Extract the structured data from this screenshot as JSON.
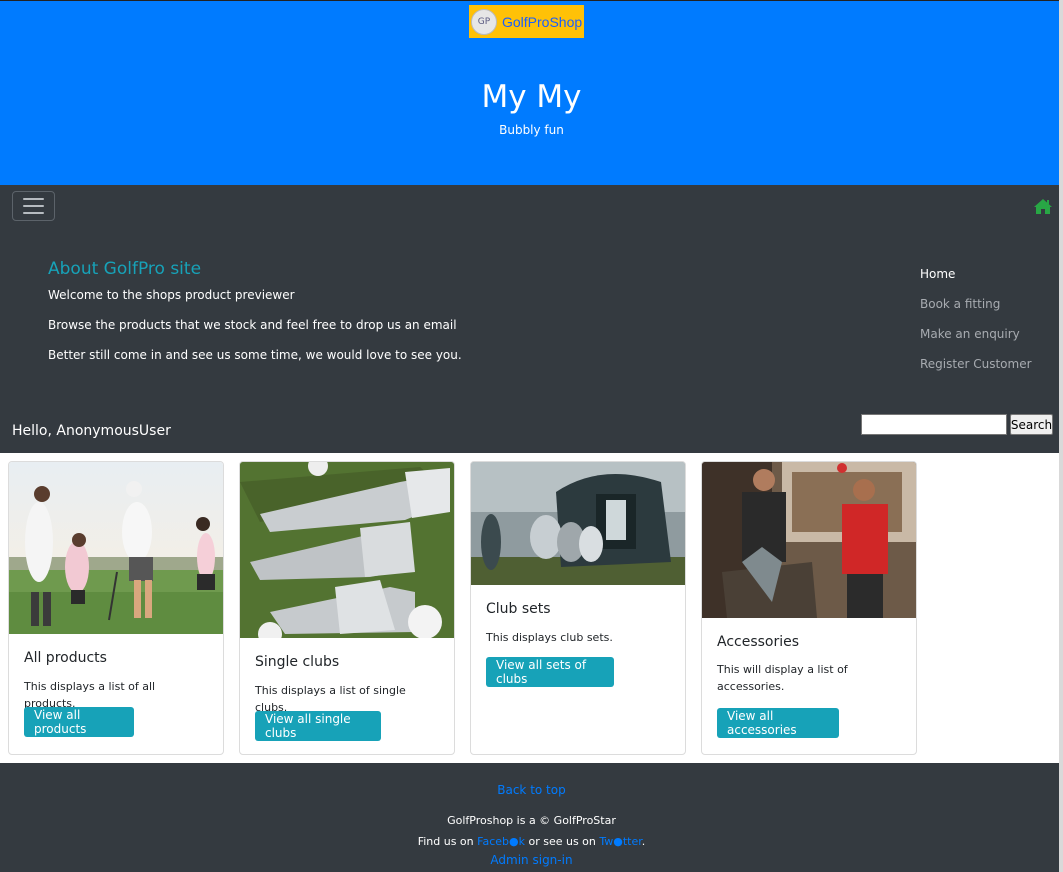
{
  "header": {
    "brand_badge": "GP",
    "brand_name": "GolfProShop",
    "title": "My My",
    "subtitle": "Bubbly fun"
  },
  "navbar": {
    "toggle_icon": "hamburger-icon",
    "home_icon": "home-icon",
    "about": {
      "title": "About GolfPro site",
      "lines": [
        "Welcome to the shops product previewer",
        "Browse the products that we stock and feel free to drop us an email",
        "Better still come in and see us some time, we would love to see you."
      ]
    },
    "links": [
      {
        "label": "Home",
        "active": true
      },
      {
        "label": "Book a fitting",
        "active": false
      },
      {
        "label": "Make an enquiry",
        "active": false
      },
      {
        "label": "Register Customer",
        "active": false
      }
    ],
    "greeting": "Hello, AnonymousUser",
    "search": {
      "value": "",
      "button": "Search"
    }
  },
  "cards": [
    {
      "title": "All products",
      "text": "This displays a list of all products.",
      "button": "View all products"
    },
    {
      "title": "Single clubs",
      "text": "This displays a list of single clubs.",
      "button": "View all single clubs"
    },
    {
      "title": "Club sets",
      "text": "This displays club sets.",
      "button": "View all sets of clubs"
    },
    {
      "title": "Accessories",
      "text": "This will display a list of accessories.",
      "button": "View all accessories"
    }
  ],
  "footer": {
    "back_to_top": "Back to top",
    "copyright": "GolfProshop is a © GolfProStar",
    "find_us_prefix": "Find us on ",
    "facebook": "Faceb●k",
    "find_us_mid": " or see us on ",
    "twitter": "Tw●tter",
    "find_us_suffix": ".",
    "admin": "Admin sign-in"
  },
  "colors": {
    "hero": "#007bff",
    "brand_bg": "#ffc107",
    "navbar": "#343a40",
    "accent": "#17a2b8",
    "home_icon": "#28a745"
  }
}
